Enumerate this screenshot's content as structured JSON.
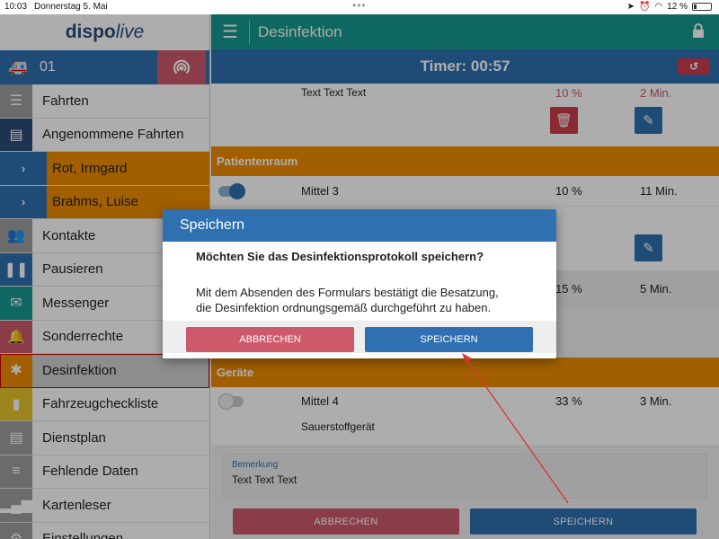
{
  "status_bar": {
    "time": "10:03",
    "date": "Donnerstag 5. Mai",
    "battery": "12 %"
  },
  "sidebar": {
    "logo_dispo": "dispo",
    "logo_live": "live",
    "vehicle_number": "01",
    "items": [
      {
        "label": "Fahrten",
        "icon": "list-icon",
        "color": "#9e9e9e"
      },
      {
        "label": "Angenommene Fahrten",
        "icon": "id-card-icon",
        "color": "#2d4a7a"
      },
      {
        "label": "Rot, Irmgard",
        "icon": "chevron-right-icon"
      },
      {
        "label": "Brahms, Luise",
        "icon": "chevron-right-icon"
      },
      {
        "label": "Kontakte",
        "icon": "people-icon",
        "color": "#9e9e9e"
      },
      {
        "label": "Pausieren",
        "icon": "pause-icon",
        "color": "#2e70b0"
      },
      {
        "label": "Messenger",
        "icon": "envelope-icon",
        "color": "#16998e"
      },
      {
        "label": "Sonderrechte",
        "icon": "bell-icon",
        "color": "#cc5a6b"
      },
      {
        "label": "Desinfektion",
        "icon": "bug-icon",
        "color": "#ef8c00"
      },
      {
        "label": "Fahrzeugcheckliste",
        "icon": "book-icon",
        "color": "#e8c42c"
      },
      {
        "label": "Dienstplan",
        "icon": "list-alt-icon",
        "color": "#9e9e9e"
      },
      {
        "label": "Fehlende Daten",
        "icon": "database-icon",
        "color": "#9e9e9e"
      },
      {
        "label": "Kartenleser",
        "icon": "signal-icon",
        "color": "#9e9e9e"
      },
      {
        "label": "Einstellungen",
        "icon": "gear-icon",
        "color": "#9e9e9e"
      }
    ]
  },
  "header": {
    "title": "Desinfektion"
  },
  "timer": {
    "label": "Timer: 00:57"
  },
  "content": {
    "row_top": {
      "name": "Text Text Text",
      "percent": "10 %",
      "time": "2 Min."
    },
    "section_patientenraum": "Patientenraum",
    "row_mittel3": {
      "name": "Mittel 3",
      "percent": "10 %",
      "time": "11 Min."
    },
    "row_hidden": {
      "percent": "15 %",
      "time": "5 Min."
    },
    "section_geraete": "Geräte",
    "row_mittel4": {
      "name": "Mittel 4",
      "percent": "33 %",
      "time": "3 Min."
    },
    "row_device": {
      "name": "Sauerstoffgerät"
    },
    "remark_label": "Bemerkung",
    "remark_value": "Text Text Text",
    "cancel_label": "ABBRECHEN",
    "save_label": "SPEICHERN"
  },
  "dialog": {
    "title": "Speichern",
    "question": "Möchten Sie das Desinfektionsprotokoll speichern?",
    "text_line1": "Mit dem Absenden des Formulars bestätigt die Besatzung,",
    "text_line2": "die Desinfektion ordnungsgemäß durchgeführt zu haben.",
    "cancel_label": "ABBRECHEN",
    "save_label": "SPEICHERN"
  }
}
